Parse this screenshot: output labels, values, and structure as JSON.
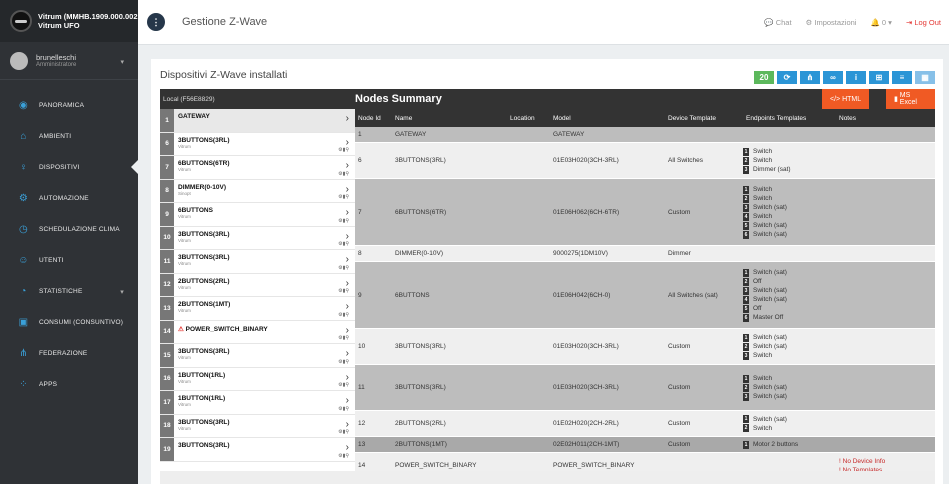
{
  "brand": {
    "line1": "Vitrum (MMHB.1909.000.002",
    "line2": "Vitrum UFO"
  },
  "user": {
    "name": "brunelleschi",
    "role": "Amministratore"
  },
  "menu": [
    {
      "label": "PANORAMICA",
      "icon": "dashboard-icon"
    },
    {
      "label": "AMBIENTI",
      "icon": "home-icon"
    },
    {
      "label": "DISPOSITIVI",
      "icon": "bulb-icon",
      "active": true
    },
    {
      "label": "AUTOMAZIONE",
      "icon": "robot-icon"
    },
    {
      "label": "SCHEDULAZIONE CLIMA",
      "icon": "clock-icon"
    },
    {
      "label": "UTENTI",
      "icon": "users-icon"
    },
    {
      "label": "STATISTICHE",
      "icon": "pie-icon"
    },
    {
      "label": "CONSUMI (CONSUNTIVO)",
      "icon": "meter-icon"
    },
    {
      "label": "FEDERAZIONE",
      "icon": "network-icon"
    },
    {
      "label": "APPS",
      "icon": "apps-icon"
    }
  ],
  "topbar": {
    "title": "Gestione Z-Wave",
    "chat": "Chat",
    "settings": "Impostazioni",
    "notifications": "0",
    "logout": "Log Out"
  },
  "card": {
    "title": "Dispositivi Z-Wave installati",
    "count": "20"
  },
  "header": {
    "local": "Local (F56E8829)",
    "title": "Nodes Summary",
    "html_btn": "</> HTML",
    "excel_btn": "MS Excel"
  },
  "left_nodes": [
    {
      "num": "1",
      "name": "GATEWAY",
      "sub": ""
    },
    {
      "num": "6",
      "name": "3BUTTONS(3RL)",
      "sub": "Vitrum"
    },
    {
      "num": "7",
      "name": "6BUTTONS(6TR)",
      "sub": "Vitrum"
    },
    {
      "num": "8",
      "name": "DIMMER(0-10V)",
      "sub": "Sinopt"
    },
    {
      "num": "9",
      "name": "6BUTTONS",
      "sub": "Vitrum"
    },
    {
      "num": "10",
      "name": "3BUTTONS(3RL)",
      "sub": "Vitrum"
    },
    {
      "num": "11",
      "name": "3BUTTONS(3RL)",
      "sub": "Vitrum"
    },
    {
      "num": "12",
      "name": "2BUTTONS(2RL)",
      "sub": "Vitrum"
    },
    {
      "num": "13",
      "name": "2BUTTONS(1MT)",
      "sub": "Vitrum"
    },
    {
      "num": "14",
      "name": "POWER_SWITCH_BINARY",
      "sub": ""
    },
    {
      "num": "15",
      "name": "3BUTTONS(3RL)",
      "sub": "Vitrum"
    },
    {
      "num": "16",
      "name": "1BUTTON(1RL)",
      "sub": "Vitrum"
    },
    {
      "num": "17",
      "name": "1BUTTON(1RL)",
      "sub": "Vitrum"
    },
    {
      "num": "18",
      "name": "3BUTTONS(3RL)",
      "sub": "Vitrum"
    },
    {
      "num": "19",
      "name": "3BUTTONS(3RL)",
      "sub": ""
    }
  ],
  "columns": [
    "Node Id",
    "Name",
    "Location",
    "Model",
    "Device Template",
    "Endpoints Templates",
    "Notes"
  ],
  "rows": [
    {
      "id": "1",
      "name": "GATEWAY",
      "loc": "",
      "model": "GATEWAY",
      "tpl": "",
      "eps": [],
      "notes": [],
      "style": "g"
    },
    {
      "id": "6",
      "name": "3BUTTONS(3RL)",
      "loc": "",
      "model": "01E03H020(3CH-3RL)",
      "tpl": "All Switches",
      "eps": [
        "Switch",
        "Switch",
        "Dimmer (sat)"
      ],
      "notes": [],
      "style": "w"
    },
    {
      "id": "7",
      "name": "6BUTTONS(6TR)",
      "loc": "",
      "model": "01E06H062(6CH-6TR)",
      "tpl": "Custom",
      "eps": [
        "Switch",
        "Switch",
        "Switch (sat)",
        "Switch",
        "Switch (sat)",
        "Switch (sat)"
      ],
      "notes": [],
      "style": "g"
    },
    {
      "id": "8",
      "name": "DIMMER(0-10V)",
      "loc": "",
      "model": "9000275(1DM10V)",
      "tpl": "Dimmer",
      "eps": [],
      "notes": [],
      "style": "w"
    },
    {
      "id": "9",
      "name": "6BUTTONS",
      "loc": "",
      "model": "01E06H042(6CH-0)",
      "tpl": "All Switches (sat)",
      "eps": [
        "Switch (sat)",
        "Off",
        "Switch (sat)",
        "Switch (sat)",
        "Off",
        "Master Off"
      ],
      "notes": [],
      "style": "g"
    },
    {
      "id": "10",
      "name": "3BUTTONS(3RL)",
      "loc": "",
      "model": "01E03H020(3CH-3RL)",
      "tpl": "Custom",
      "eps": [
        "Switch (sat)",
        "Switch (sat)",
        "Switch"
      ],
      "notes": [],
      "style": "w"
    },
    {
      "id": "11",
      "name": "3BUTTONS(3RL)",
      "loc": "",
      "model": "01E03H020(3CH-3RL)",
      "tpl": "Custom",
      "eps": [
        "Switch",
        "Switch (sat)",
        "Switch (sat)"
      ],
      "notes": [],
      "style": "g"
    },
    {
      "id": "12",
      "name": "2BUTTONS(2RL)",
      "loc": "",
      "model": "01E02H020(2CH-2RL)",
      "tpl": "Custom",
      "eps": [
        "Switch (sat)",
        "Switch"
      ],
      "notes": [],
      "style": "w"
    },
    {
      "id": "13",
      "name": "2BUTTONS(1MT)",
      "loc": "",
      "model": "02E02H011(2CH-1MT)",
      "tpl": "Custom",
      "eps": [
        "Motor 2 buttons"
      ],
      "notes": [],
      "style": "gd"
    },
    {
      "id": "14",
      "name": "POWER_SWITCH_BINARY",
      "loc": "",
      "model": "POWER_SWITCH_BINARY",
      "tpl": "",
      "eps": [],
      "notes": [
        "No Device Info",
        "No Templates"
      ],
      "style": "w"
    }
  ]
}
